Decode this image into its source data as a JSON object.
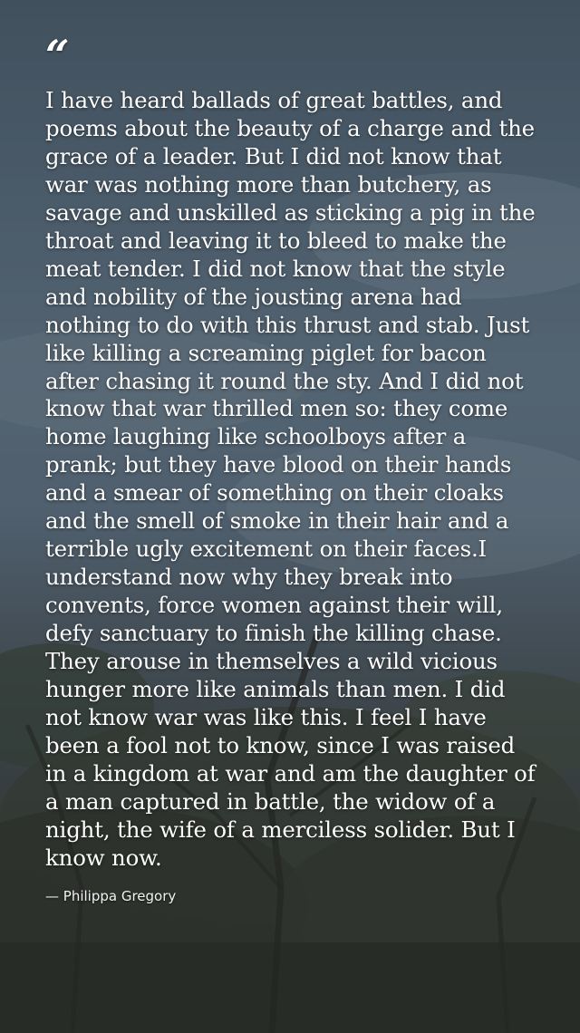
{
  "quote": {
    "mark": "“",
    "text": "I have heard ballads of great battles, and poems about the beauty of a charge and the grace of a leader. But I did not know that war was nothing more than butchery, as savage and unskilled as sticking a pig in the throat and leaving it to bleed to make the meat tender. I did not know that the style and nobility of the jousting arena had nothing to do with this thrust and stab. Just like killing a screaming piglet for bacon after chasing it round the sty. And I did not know that war thrilled men so: they come home laughing like schoolboys after a prank; but they have blood on their hands and a smear of something on their cloaks and the smell of smoke in their hair and a terrible ugly excitement on their faces.I understand now why they break into convents, force women against their will, defy sanctuary to finish the killing chase. They arouse in themselves a wild vicious hunger more like animals than men. I did not know war was like this. I feel I have been a fool not to know, since I was raised in a kingdom at war and am the daughter of a man captured in battle, the widow of a night, the wife of a merciless solider. But I know now.",
    "author": "— Philippa Gregory"
  },
  "colors": {
    "sky_top": "#536574",
    "sky_mid": "#6b7f90",
    "foliage": "#33352d",
    "text": "#ffffff"
  },
  "background": {
    "scene": "sky-and-tree-photo"
  }
}
